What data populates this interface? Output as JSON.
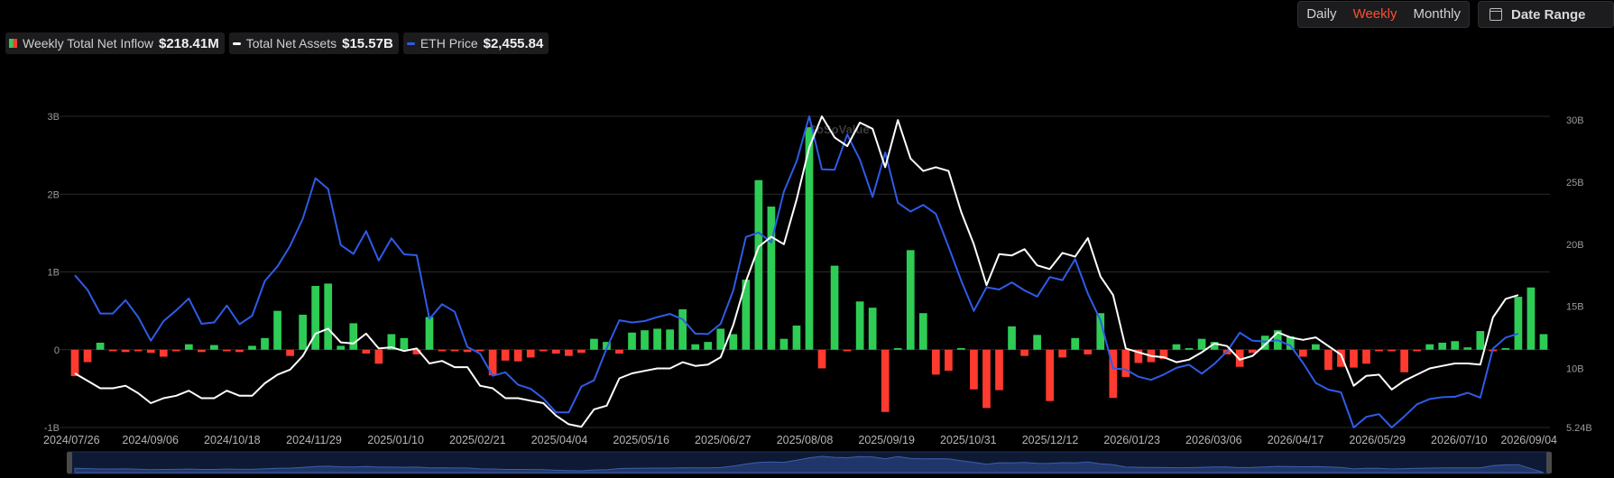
{
  "toolbar": {
    "periods": [
      "Daily",
      "Weekly",
      "Monthly"
    ],
    "active_period": "Weekly",
    "date_range_label": "Date Range"
  },
  "legend": [
    {
      "label": "Weekly Total Net Inflow",
      "value": "$218.41M"
    },
    {
      "label": "Total Net Assets",
      "value": "$15.57B"
    },
    {
      "label": "ETH Price",
      "value": "$2,455.84"
    }
  ],
  "watermark": "SoSoValue",
  "colors": {
    "positive": "#2ecc55",
    "negative": "#ff3b30",
    "assets_line": "#ffffff",
    "price_line": "#2f5be8"
  },
  "chart_data": {
    "type": "bar",
    "x_ticks": [
      "2024/07/26",
      "2024/09/06",
      "2024/10/18",
      "2024/11/29",
      "2025/01/10",
      "2025/02/21",
      "2025/04/04",
      "2025/05/16",
      "2025/06/27",
      "2025/08/08",
      "2025/09/19",
      "2025/10/31",
      "2025/12/12",
      "2026/01/23",
      "2026/03/06",
      "2026/04/17",
      "2026/05/29",
      "2026/07/10",
      "2026/09/04"
    ],
    "y_left_ticks": [
      "3B",
      "2B",
      "1B",
      "0",
      "-1B"
    ],
    "y_left_range": [
      -1,
      3
    ],
    "y_right_ticks": [
      "30B",
      "25B",
      "20B",
      "15B",
      "10B",
      "5.24B"
    ],
    "y_right_range": [
      5.24,
      30.3
    ],
    "grid": true,
    "series": [
      {
        "name": "Weekly Total Net Inflow",
        "unit": "B",
        "values": [
          -0.34,
          -0.16,
          0.09,
          -0.02,
          -0.03,
          -0.02,
          -0.04,
          -0.09,
          -0.02,
          0.07,
          -0.03,
          0.06,
          -0.02,
          -0.03,
          0.05,
          0.15,
          0.5,
          -0.08,
          0.45,
          0.82,
          0.85,
          0.05,
          0.34,
          -0.05,
          -0.18,
          0.2,
          0.15,
          -0.06,
          0.42,
          -0.02,
          -0.02,
          -0.03,
          -0.02,
          -0.33,
          -0.14,
          -0.15,
          -0.1,
          -0.02,
          -0.05,
          -0.08,
          -0.04,
          0.14,
          0.1,
          -0.05,
          0.22,
          0.25,
          0.27,
          0.26,
          0.52,
          0.07,
          0.1,
          0.27,
          0.2,
          0.9,
          2.18,
          1.84,
          0.14,
          0.31,
          2.86,
          -0.24,
          1.08,
          -0.02,
          0.62,
          0.54,
          -0.8,
          0.02,
          1.28,
          0.47,
          -0.32,
          -0.27,
          0.02,
          -0.51,
          -0.75,
          -0.52,
          0.3,
          -0.08,
          0.19,
          -0.66,
          -0.1,
          0.15,
          -0.06,
          0.47,
          -0.62,
          -0.35,
          -0.17,
          -0.16,
          -0.12,
          0.07,
          0.02,
          0.14,
          0.1,
          -0.06,
          -0.22,
          -0.04,
          0.18,
          0.25,
          0.17,
          -0.09,
          0.07,
          -0.26,
          -0.22,
          -0.23,
          -0.18,
          -0.02,
          -0.02,
          -0.29,
          -0.02,
          0.07,
          0.09,
          0.11,
          0.03,
          0.24,
          -0.02,
          0.02,
          0.68,
          0.8,
          0.2
        ]
      },
      {
        "name": "Total Net Assets",
        "unit": "B",
        "values": [
          9.6,
          9.0,
          8.4,
          8.4,
          8.6,
          8.0,
          7.2,
          7.6,
          7.8,
          8.2,
          7.6,
          7.6,
          8.2,
          7.8,
          7.8,
          8.8,
          9.5,
          9.9,
          11.0,
          12.8,
          13.2,
          12.1,
          12.0,
          12.8,
          11.6,
          11.7,
          11.4,
          11.6,
          10.4,
          10.6,
          10.1,
          10.1,
          8.6,
          8.4,
          7.6,
          7.6,
          7.4,
          7.2,
          6.2,
          5.5,
          5.3,
          6.7,
          7.0,
          9.2,
          9.6,
          9.8,
          10.0,
          10.0,
          10.5,
          10.2,
          10.3,
          10.9,
          13.5,
          17.0,
          19.8,
          20.6,
          20.0,
          23.6,
          27.8,
          30.3,
          28.6,
          27.9,
          29.8,
          29.3,
          26.2,
          30.0,
          26.9,
          25.9,
          26.2,
          25.9,
          22.6,
          20.0,
          16.7,
          19.2,
          19.1,
          19.6,
          18.3,
          18.0,
          19.3,
          19.0,
          20.5,
          17.4,
          15.9,
          11.6,
          11.3,
          11.0,
          10.9,
          10.5,
          10.7,
          11.3,
          12.0,
          11.8,
          10.7,
          11.0,
          11.9,
          12.9,
          12.5,
          12.3,
          12.5,
          11.8,
          11.1,
          8.6,
          9.4,
          9.5,
          8.3,
          9.0,
          9.5,
          10.0,
          10.2,
          10.4,
          10.4,
          10.3,
          14.1,
          15.6,
          15.9
        ]
      },
      {
        "name": "ETH Price",
        "unit": "USD",
        "values": [
          3420,
          3090,
          2560,
          2560,
          2860,
          2480,
          1950,
          2390,
          2630,
          2900,
          2330,
          2360,
          2740,
          2320,
          2510,
          3290,
          3620,
          4080,
          4690,
          5600,
          5360,
          4100,
          3900,
          4410,
          3750,
          4250,
          3890,
          3870,
          2440,
          2770,
          2600,
          1810,
          1660,
          1160,
          1240,
          960,
          870,
          650,
          340,
          340,
          920,
          1060,
          1780,
          2410,
          2360,
          2390,
          2480,
          2550,
          2430,
          2110,
          2100,
          2330,
          3080,
          4280,
          4380,
          4160,
          5300,
          5980,
          6990,
          5800,
          5790,
          6580,
          6020,
          5180,
          6180,
          5050,
          4850,
          5000,
          4800,
          4060,
          3300,
          2620,
          3150,
          3100,
          3260,
          3080,
          2940,
          3380,
          3310,
          3780,
          3010,
          2410,
          1330,
          1300,
          1140,
          1070,
          1190,
          1340,
          1410,
          1210,
          1430,
          1710,
          2130,
          1950,
          1930,
          1960,
          1840,
          1450,
          1000,
          850,
          790,
          0,
          240,
          300,
          0,
          250,
          520,
          640,
          680,
          690,
          780,
          670,
          1770,
          2020,
          2110
        ]
      }
    ],
    "price_axis_range": [
      0,
      6990
    ]
  }
}
